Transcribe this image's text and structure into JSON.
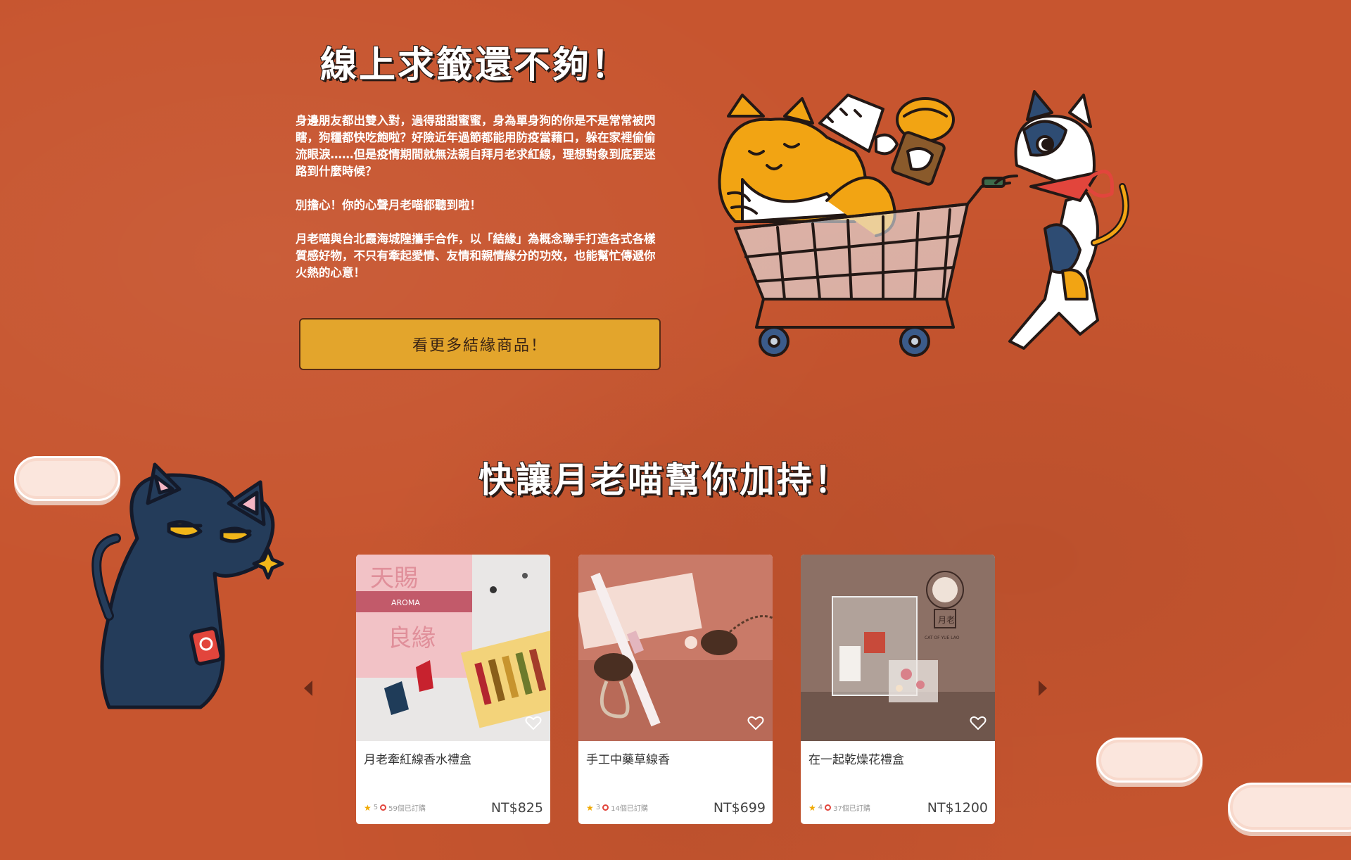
{
  "section1": {
    "title": "線上求籤還不夠！",
    "paragraphs": [
      "身邊朋友都出雙入對，過得甜甜蜜蜜，身為單身狗的你是不是常常被閃瞎，狗糧都快吃飽啦？好險近年過節都能用防疫當藉口，躲在家裡偷偷流眼淚……但是疫情期間就無法親自拜月老求紅線，理想對象到底要迷路到什麼時候？",
      "別擔心！你的心聲月老喵都聽到啦！",
      "月老喵與台北霞海城隍攜手合作，以「結緣」為概念聯手打造各式各樣質感好物，不只有牽起愛情、友情和親情緣分的功效，也能幫忙傳遞你火熱的心意！"
    ],
    "cta_label": "看更多結緣商品！"
  },
  "section2": {
    "title": "快讓月老喵幫你加持！"
  },
  "products": [
    {
      "name": "月老牽紅線香水禮盒",
      "rating": "5",
      "sold": "59個已訂購",
      "price": "NT$825"
    },
    {
      "name": "手工中藥草線香",
      "rating": "3",
      "sold": "14個已訂購",
      "price": "NT$699"
    },
    {
      "name": "在一起乾燥花禮盒",
      "rating": "4",
      "sold": "37個已訂購",
      "price": "NT$1200"
    }
  ],
  "image_text": {
    "box_top": "天賜",
    "box_bottom": "良緣",
    "box_band": "AROMA",
    "yuelao_seal": "月老",
    "yuelao_caption": "CAT OF YUE LAO"
  },
  "colors": {
    "background": "#c7552f",
    "cta": "#e3a52c",
    "heading": "#ffffff",
    "star": "#f0a900"
  },
  "icons": {
    "heart": "heart-outline-icon",
    "star": "star-icon",
    "fire": "fire-icon",
    "left": "chevron-left-icon",
    "right": "chevron-right-icon"
  }
}
